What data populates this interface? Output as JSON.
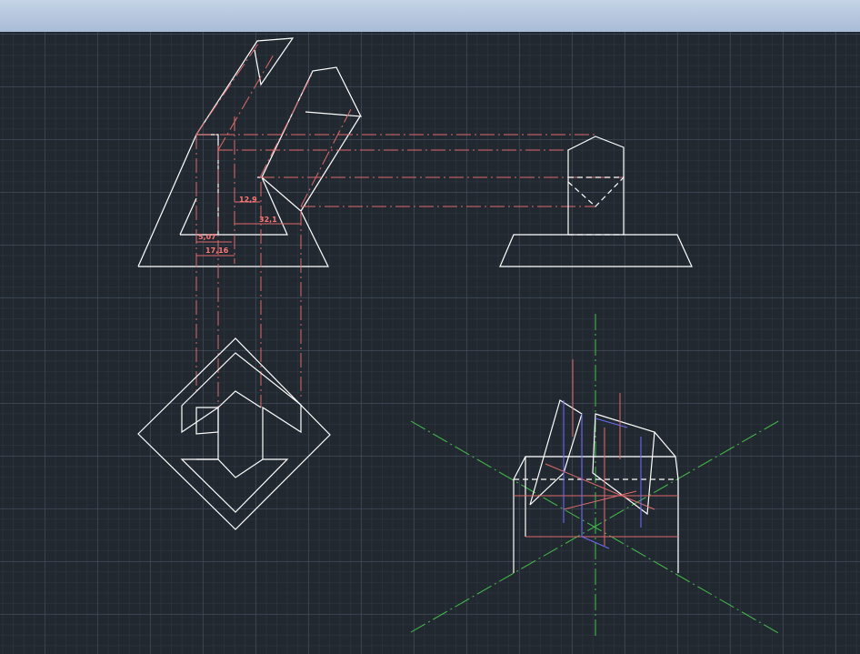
{
  "dimensions": {
    "d1": "12,9",
    "d2": "32,1",
    "d3": "5,07",
    "d4": "17,16"
  },
  "colors": {
    "background": "#212830",
    "object_lines": "#ffffff",
    "projection_lines": "#e06a6a",
    "axis_lines": "#44c24a",
    "auxiliary_lines": "#6b6bf0"
  }
}
